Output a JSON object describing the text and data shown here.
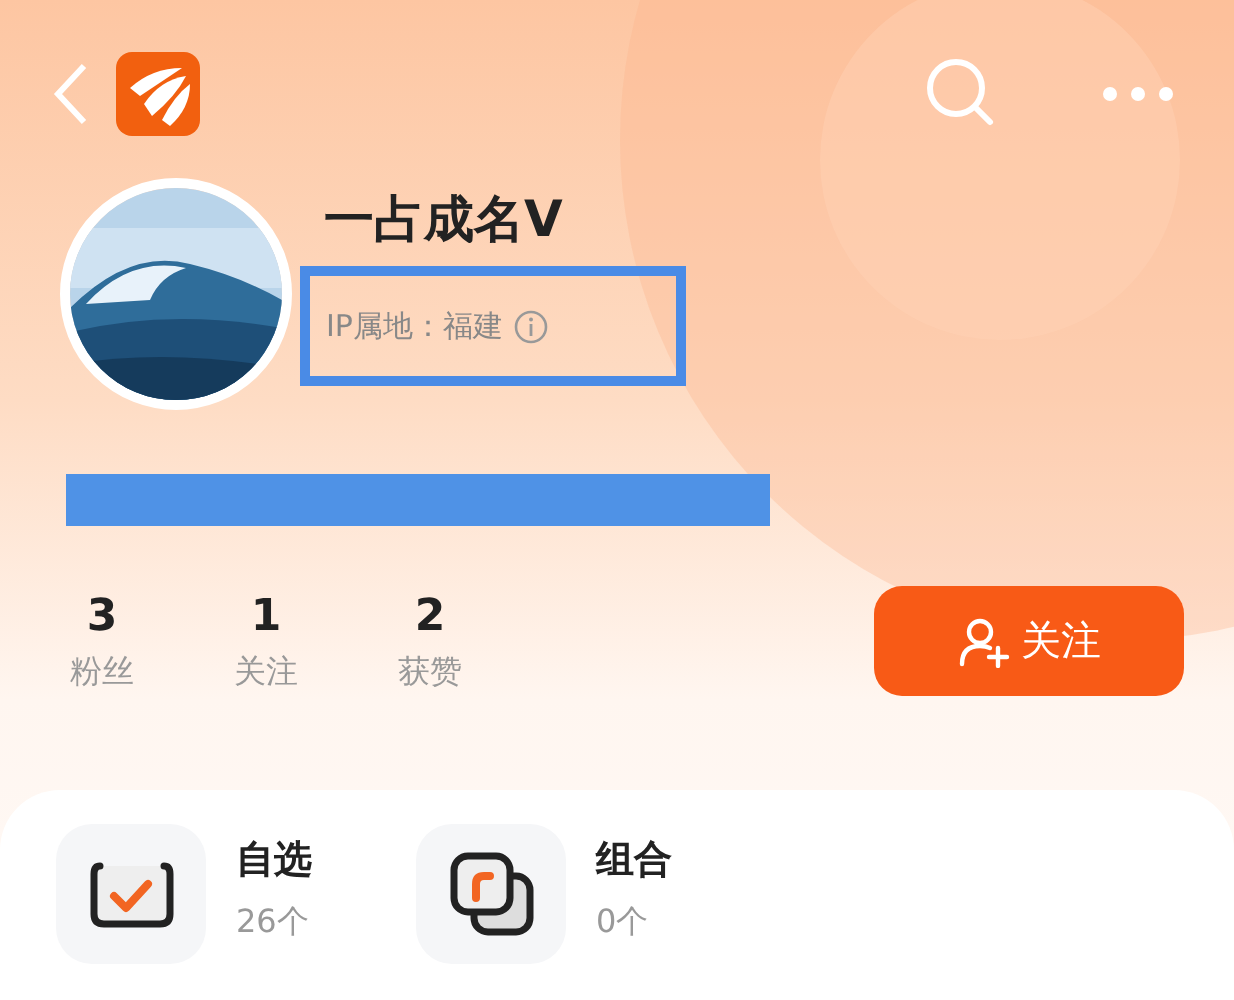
{
  "profile": {
    "name": "一占成名V",
    "ip_location": "IP属地：福建"
  },
  "stats": [
    {
      "value": "3",
      "label": "粉丝"
    },
    {
      "value": "1",
      "label": "关注"
    },
    {
      "value": "2",
      "label": "获赞"
    }
  ],
  "follow_button": {
    "label": "关注"
  },
  "collections": [
    {
      "kind": "watchlist",
      "title": "自选",
      "count": "26个"
    },
    {
      "kind": "portfolio",
      "title": "组合",
      "count": "0个"
    }
  ]
}
